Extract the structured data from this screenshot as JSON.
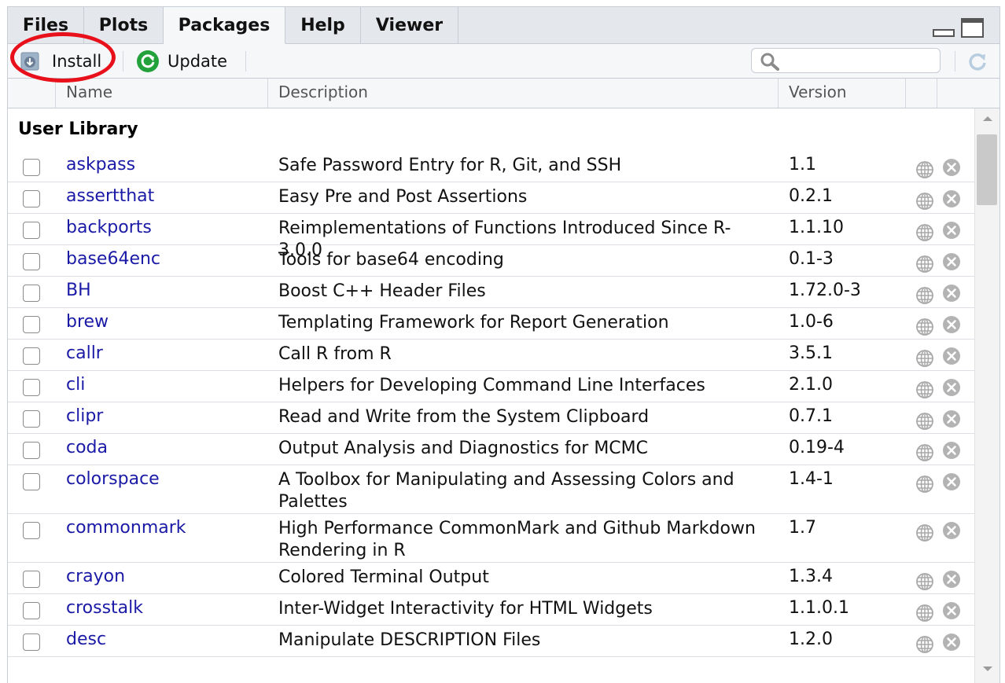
{
  "tabs": [
    {
      "label": "Files",
      "active": false
    },
    {
      "label": "Plots",
      "active": false
    },
    {
      "label": "Packages",
      "active": true
    },
    {
      "label": "Help",
      "active": false
    },
    {
      "label": "Viewer",
      "active": false
    }
  ],
  "toolbar": {
    "install_label": "Install",
    "update_label": "Update",
    "search_placeholder": "",
    "refresh_icon": "refresh-icon"
  },
  "columns": {
    "name": "Name",
    "description": "Description",
    "version": "Version"
  },
  "library_header": "User Library",
  "packages": [
    {
      "name": "askpass",
      "description": "Safe Password Entry for R, Git, and SSH",
      "version": "1.1"
    },
    {
      "name": "assertthat",
      "description": "Easy Pre and Post Assertions",
      "version": "0.2.1"
    },
    {
      "name": "backports",
      "description": "Reimplementations of Functions Introduced Since R-3.0.0",
      "version": "1.1.10"
    },
    {
      "name": "base64enc",
      "description": "Tools for base64 encoding",
      "version": "0.1-3"
    },
    {
      "name": "BH",
      "description": "Boost C++ Header Files",
      "version": "1.72.0-3"
    },
    {
      "name": "brew",
      "description": "Templating Framework for Report Generation",
      "version": "1.0-6"
    },
    {
      "name": "callr",
      "description": "Call R from R",
      "version": "3.5.1"
    },
    {
      "name": "cli",
      "description": "Helpers for Developing Command Line Interfaces",
      "version": "2.1.0"
    },
    {
      "name": "clipr",
      "description": "Read and Write from the System Clipboard",
      "version": "0.7.1"
    },
    {
      "name": "coda",
      "description": "Output Analysis and Diagnostics for MCMC",
      "version": "0.19-4"
    },
    {
      "name": "colorspace",
      "description": "A Toolbox for Manipulating and Assessing Colors and Palettes",
      "version": "1.4-1"
    },
    {
      "name": "commonmark",
      "description": "High Performance CommonMark and Github Markdown Rendering in R",
      "version": "1.7"
    },
    {
      "name": "crayon",
      "description": "Colored Terminal Output",
      "version": "1.3.4"
    },
    {
      "name": "crosstalk",
      "description": "Inter-Widget Interactivity for HTML Widgets",
      "version": "1.1.0.1"
    },
    {
      "name": "desc",
      "description": "Manipulate DESCRIPTION Files",
      "version": "1.2.0"
    }
  ],
  "colors": {
    "link": "#1a1aa6",
    "highlight": "#e8101a",
    "update_green": "#23a13a"
  }
}
